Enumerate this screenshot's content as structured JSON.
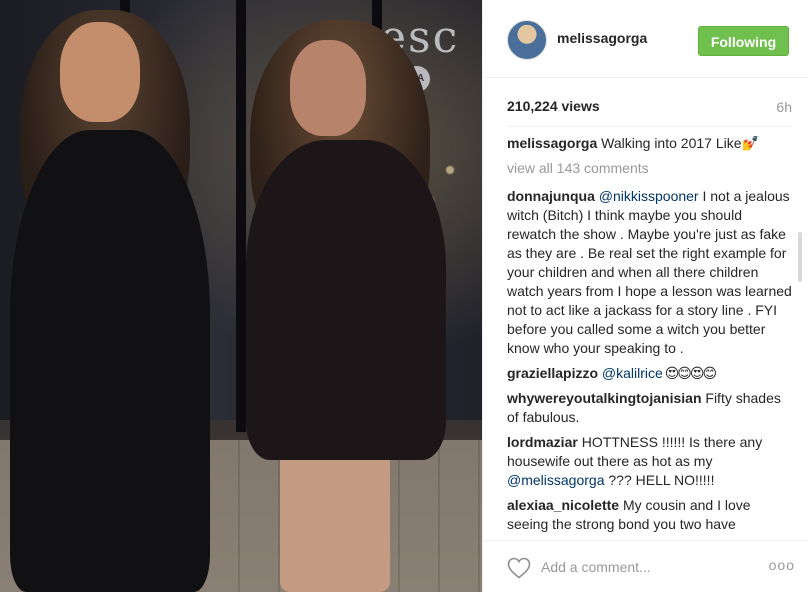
{
  "media": {
    "sign_text": "esc",
    "badge_text": "DA"
  },
  "header": {
    "username": "melissagorga",
    "follow_label": "Following"
  },
  "post": {
    "views": "210,224 views",
    "time_ago": "6h",
    "caption_user": "melissagorga",
    "caption_text": " Walking into 2017 Like",
    "caption_emoji": "💅",
    "view_all": "view all 143 comments"
  },
  "comments": [
    {
      "user": "donnajunqua",
      "mention": "@nikkisspooner",
      "text": " I not a jealous witch (Bitch) I think maybe you should rewatch the show . Maybe you're just as fake as they are . Be real set the right example for your children and when all there children watch years from I hope a lesson was learned not to act like a jackass for a story line . FYI before you called some a witch you better know who your speaking to ."
    },
    {
      "user": "graziellapizzo",
      "mention": "@kalilrice",
      "text": " 😍😊😍😊"
    },
    {
      "user": "whywereyoutalkingtojanisian",
      "mention": "",
      "text": " Fifty shades of fabulous."
    },
    {
      "user": "lordmaziar",
      "mention": "",
      "text": " HOTTNESS !!!!!! Is there any housewife out there as hot as my ",
      "mention2": "@melissagorga",
      "text2": " ??? HELL NO!!!!!"
    },
    {
      "user": "alexiaa_nicolette",
      "mention": "",
      "text": " My cousin and I love seeing the strong bond you two have"
    }
  ],
  "footer": {
    "comment_placeholder": "Add a comment...",
    "more_label": "ooo"
  },
  "colors": {
    "follow_button": "#70c050",
    "mention": "#003569",
    "muted": "#999999"
  },
  "icons": {
    "like": "heart-outline-icon",
    "more": "more-options-icon"
  }
}
